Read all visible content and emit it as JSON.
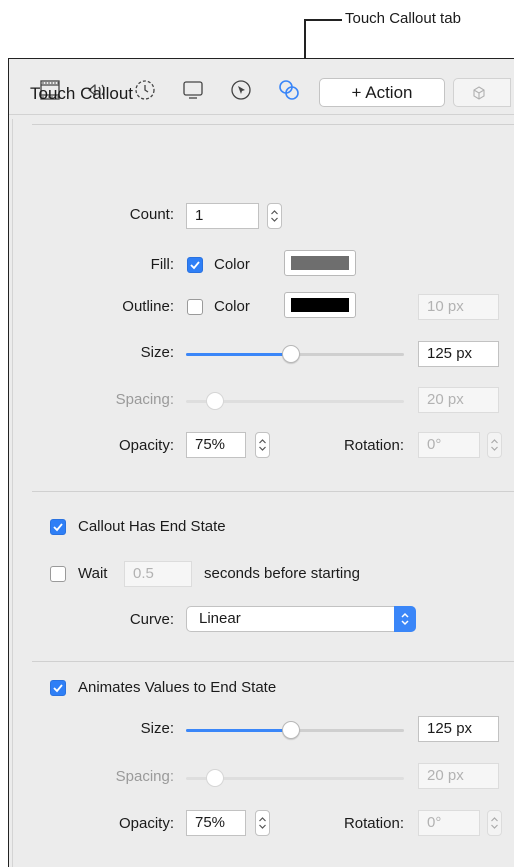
{
  "callout": {
    "label": "Touch Callout tab"
  },
  "toolbar": {
    "icons": [
      "film-icon",
      "audio-icon",
      "clock-icon",
      "screen-icon",
      "cursor-icon",
      "touch-callout-icon",
      "pen-icon",
      "text-icon",
      "transform-icon"
    ],
    "active_icon": "touch-callout-icon",
    "accent_color": "#3a86f8"
  },
  "header": {
    "title": "Touch Callout",
    "action_label": "+ Action"
  },
  "appearance": {
    "count": {
      "label": "Count:",
      "value": "1"
    },
    "fill": {
      "label": "Fill:",
      "checkbox_label": "Color",
      "checked": true,
      "color": "#6e6e6e"
    },
    "outline": {
      "label": "Outline:",
      "checkbox_label": "Color",
      "checked": false,
      "color": "#000000",
      "width": "10 px"
    },
    "size": {
      "label": "Size:",
      "value": "125 px",
      "level": 0.48
    },
    "spacing": {
      "label": "Spacing:",
      "value": "20 px",
      "level": 0.1
    },
    "opacity": {
      "label": "Opacity:",
      "value": "75%"
    },
    "rotation": {
      "label": "Rotation:",
      "value": "0°"
    }
  },
  "end_state": {
    "has_end_state_label": "Callout Has End State",
    "has_end_state_checked": true,
    "wait_label": "Wait",
    "wait_checked": false,
    "wait_value": "0.5",
    "wait_suffix": "seconds before starting",
    "curve_label": "Curve:",
    "curve_value": "Linear"
  },
  "animate": {
    "label": "Animates Values to End State",
    "checked": true,
    "size": {
      "label": "Size:",
      "value": "125 px",
      "level": 0.48
    },
    "spacing": {
      "label": "Spacing:",
      "value": "20 px",
      "level": 0.1
    },
    "opacity": {
      "label": "Opacity:",
      "value": "75%"
    },
    "rotation": {
      "label": "Rotation:",
      "value": "0°"
    }
  }
}
